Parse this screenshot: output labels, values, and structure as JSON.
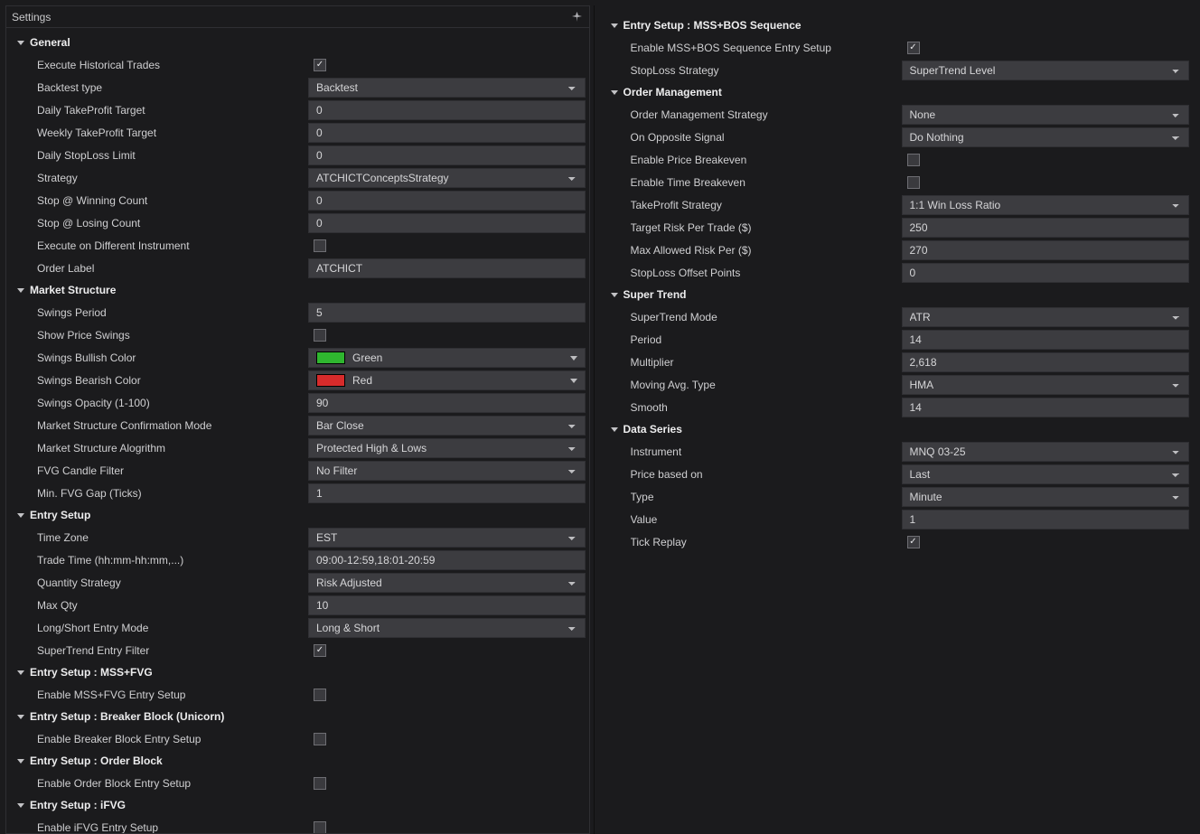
{
  "panelTitle": "Settings",
  "left": {
    "general": {
      "title": "General",
      "executeHistoricalTrades": {
        "label": "Execute Historical Trades",
        "checked": true
      },
      "backtestType": {
        "label": "Backtest type",
        "value": "Backtest"
      },
      "dailyTakeProfit": {
        "label": "Daily TakeProfit Target",
        "value": "0"
      },
      "weeklyTakeProfit": {
        "label": "Weekly TakeProfit Target",
        "value": "0"
      },
      "dailyStopLoss": {
        "label": "Daily StopLoss Limit",
        "value": "0"
      },
      "strategy": {
        "label": "Strategy",
        "value": "ATCHICTConceptsStrategy"
      },
      "stopWinningCount": {
        "label": "Stop @ Winning Count",
        "value": "0"
      },
      "stopLosingCount": {
        "label": "Stop @ Losing Count",
        "value": "0"
      },
      "execDiffInstr": {
        "label": "Execute on Different Instrument",
        "checked": false
      },
      "orderLabel": {
        "label": "Order Label",
        "value": "ATCHICT"
      }
    },
    "marketStructure": {
      "title": "Market Structure",
      "swingsPeriod": {
        "label": "Swings Period",
        "value": "5"
      },
      "showPriceSwings": {
        "label": "Show Price Swings",
        "checked": false
      },
      "swingsBullishColor": {
        "label": "Swings Bullish Color",
        "value": "Green",
        "hex": "#2fb62f"
      },
      "swingsBearishColor": {
        "label": "Swings Bearish Color",
        "value": "Red",
        "hex": "#d62b2b"
      },
      "swingsOpacity": {
        "label": "Swings Opacity (1-100)",
        "value": "90"
      },
      "confirmationMode": {
        "label": "Market Structure Confirmation Mode",
        "value": "Bar Close"
      },
      "algorithm": {
        "label": "Market Structure Alogrithm",
        "value": "Protected High & Lows"
      },
      "fvgFilter": {
        "label": "FVG Candle Filter",
        "value": "No Filter"
      },
      "minFvgGap": {
        "label": "Min. FVG Gap (Ticks)",
        "value": "1"
      }
    },
    "entrySetup": {
      "title": "Entry Setup",
      "timeZone": {
        "label": "Time Zone",
        "value": "EST"
      },
      "tradeTime": {
        "label": "Trade Time (hh:mm-hh:mm,...)",
        "value": "09:00-12:59,18:01-20:59"
      },
      "quantityStrategy": {
        "label": "Quantity Strategy",
        "value": "Risk Adjusted"
      },
      "maxQty": {
        "label": "Max Qty",
        "value": "10"
      },
      "longShortMode": {
        "label": "Long/Short Entry Mode",
        "value": "Long & Short"
      },
      "supertrendFilter": {
        "label": "SuperTrend Entry Filter",
        "checked": true
      }
    },
    "mssFvg": {
      "title": "Entry Setup : MSS+FVG",
      "enable": {
        "label": "Enable MSS+FVG Entry Setup",
        "checked": false
      }
    },
    "breakerBlock": {
      "title": "Entry Setup : Breaker Block (Unicorn)",
      "enable": {
        "label": "Enable Breaker Block Entry Setup",
        "checked": false
      }
    },
    "orderBlock": {
      "title": "Entry Setup : Order Block",
      "enable": {
        "label": "Enable Order Block Entry Setup",
        "checked": false
      }
    },
    "ifvg": {
      "title": "Entry Setup : iFVG",
      "enable": {
        "label": "Enable iFVG Entry Setup",
        "checked": false
      }
    }
  },
  "right": {
    "mssBos": {
      "title": "Entry Setup : MSS+BOS Sequence",
      "enable": {
        "label": "Enable MSS+BOS Sequence Entry Setup",
        "checked": true
      },
      "stoplossStrategy": {
        "label": "StopLoss Strategy",
        "value": "SuperTrend Level"
      }
    },
    "orderMgmt": {
      "title": "Order Management",
      "strategy": {
        "label": "Order Management Strategy",
        "value": "None"
      },
      "onOpposite": {
        "label": "On Opposite Signal",
        "value": "Do Nothing"
      },
      "priceBreakeven": {
        "label": "Enable Price Breakeven",
        "checked": false
      },
      "timeBreakeven": {
        "label": "Enable Time Breakeven",
        "checked": false
      },
      "takeProfitStrategy": {
        "label": "TakeProfit Strategy",
        "value": "1:1 Win Loss Ratio"
      },
      "targetRisk": {
        "label": "Target Risk Per Trade ($)",
        "value": "250"
      },
      "maxRisk": {
        "label": "Max Allowed Risk Per ($)",
        "value": "270"
      },
      "stopLossOffset": {
        "label": "StopLoss Offset Points",
        "value": "0"
      }
    },
    "superTrend": {
      "title": "Super Trend",
      "mode": {
        "label": "SuperTrend Mode",
        "value": "ATR"
      },
      "period": {
        "label": "Period",
        "value": "14"
      },
      "multiplier": {
        "label": "Multiplier",
        "value": "2,618"
      },
      "maType": {
        "label": "Moving Avg. Type",
        "value": "HMA"
      },
      "smooth": {
        "label": "Smooth",
        "value": "14"
      }
    },
    "dataSeries": {
      "title": "Data Series",
      "instrument": {
        "label": "Instrument",
        "value": "MNQ 03-25"
      },
      "priceBased": {
        "label": "Price based on",
        "value": "Last"
      },
      "type": {
        "label": "Type",
        "value": "Minute"
      },
      "value": {
        "label": "Value",
        "value": "1"
      },
      "tickReplay": {
        "label": "Tick Replay",
        "checked": true
      }
    }
  }
}
